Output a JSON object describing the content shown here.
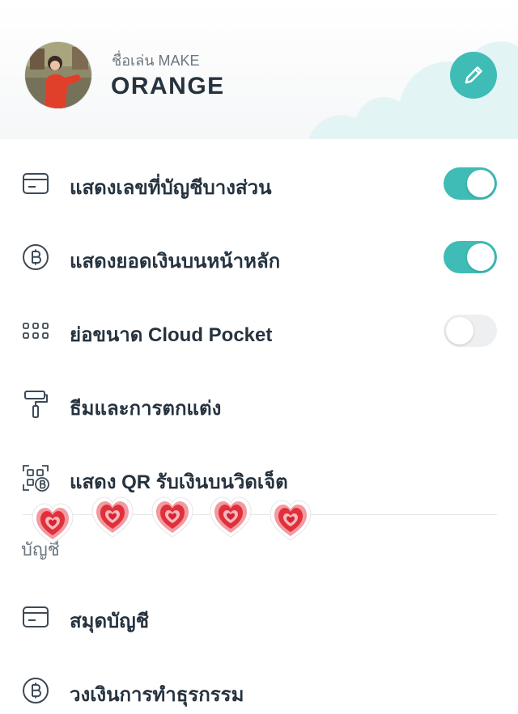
{
  "profile": {
    "nickname_label": "ชื่อเล่น MAKE",
    "nickname": "ORANGE",
    "edit_icon": "pencil-icon"
  },
  "settings": [
    {
      "label": "แสดงเลขที่บัญชีบางส่วน",
      "icon": "card-icon",
      "toggle": "on"
    },
    {
      "label": "แสดงยอดเงินบนหน้าหลัก",
      "icon": "baht-icon",
      "toggle": "on"
    },
    {
      "label": "ย่อขนาด Cloud Pocket",
      "icon": "grid-icon",
      "toggle": "off"
    },
    {
      "label": "ธีมและการตกแต่ง",
      "icon": "paint-roller-icon"
    },
    {
      "label": "แสดง QR รับเงินบนวิดเจ็ต",
      "icon": "qr-baht-icon"
    }
  ],
  "section": {
    "title": "บัญชี"
  },
  "account_items": [
    {
      "label": "สมุดบัญชี",
      "icon": "passbook-icon"
    },
    {
      "label": "วงเงินการทำธุรกรรม",
      "icon": "baht-icon"
    }
  ],
  "colors": {
    "accent": "#3fbcb6",
    "text": "#26333f",
    "muted": "#6b7680",
    "heart": "#e0303b"
  }
}
